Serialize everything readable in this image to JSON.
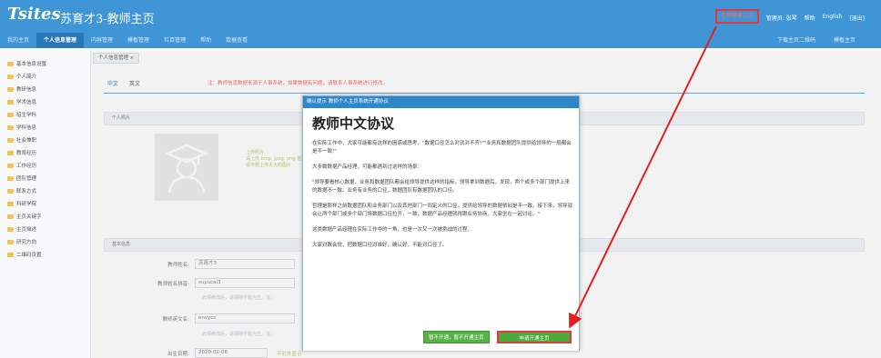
{
  "header": {
    "logo": "Tsites",
    "title": "苏育才3-教师主页",
    "links": [
      "老师管理入口",
      "管理员: 张琴",
      "帮助",
      "English",
      "[退出]"
    ],
    "nav": [
      "我的主页",
      "个人信息管理",
      "内容管理",
      "模板管理",
      "栏目管理",
      "帮助",
      "数据查看"
    ],
    "nav_active": "个人信息管理",
    "right_items": [
      "下载主页二维码",
      "模板主页"
    ]
  },
  "sidebar": {
    "items": [
      "基本信息设置",
      "个人简介",
      "教研信息",
      "学术信息",
      "招生学科",
      "学科信息",
      "社会兼职",
      "教育经历",
      "工作经历",
      "团队管理",
      "联系方式",
      "科研学院",
      "主页关键字",
      "主页描述",
      "研究方向",
      "二维码设置"
    ]
  },
  "main": {
    "tab": "个人信息管理",
    "lang_tabs": [
      "中文",
      "英文"
    ],
    "notice": "注：教师信息数据来源于人事系统，如果数据有问题，请联系人事系统进行修改。",
    "panel_personal": "个人照片",
    "upload_tip": [
      "上传照片",
      "请上传 bmp, jpeg, png 格式图片",
      "请不要上传太大的图片"
    ],
    "panel_basic": "基本信息",
    "fields": [
      {
        "label": "教师姓名:",
        "value": "苏育才3"
      },
      {
        "label": "教师姓名拼音:",
        "value": "suyucai3"
      },
      {
        "label": "教师英文名:",
        "value": "envycc"
      },
      {
        "label": "出生日期:",
        "value": "2020-02-06"
      }
    ],
    "hints": [
      "此项修改后，请保持不能为空。注：",
      "此项修改后，请保持不能为空。注：",
      "不对外显示"
    ]
  },
  "modal": {
    "header": "确认提示 教师个人主页系统开通协议",
    "title": "教师中文协议",
    "paragraphs": [
      "在实际工作中，大家可能都有这样的困惑或思考，\"数据口径怎么对就对不齐!\"\"业务和数据团队提供给领导的一般都会是不一致!\"",
      "大多数数据产品经理，可能都遇到过这样的场景：",
      "\"领导要看核心数据，业务和数据团队都会给领导提供这样的指标。领导拿到数据后，发现，两个或多个部门提供上来的数据不一致。业务有业务的口径，数据团队有数据团队的口径。",
      "哲理是那样之前数据团队和业务部门以及其他部门一同定义的口径，提供给领导的数据依旧是不一致。接下来，领导就会让两个部门或多个部门将数据口径拉齐，一致，数据产品经理就得跟业务协商，大家坐在一起讨论。\"",
      "这类数据产品经理在实际工作中的一角，也是一次又一次被挑战的过程。",
      "大家对数会觉，把数据口径对准好，确认好，不能对口径了。"
    ],
    "btn_decline": "暂不开通，暂不开通主页",
    "btn_accept": "申请开通主页"
  }
}
